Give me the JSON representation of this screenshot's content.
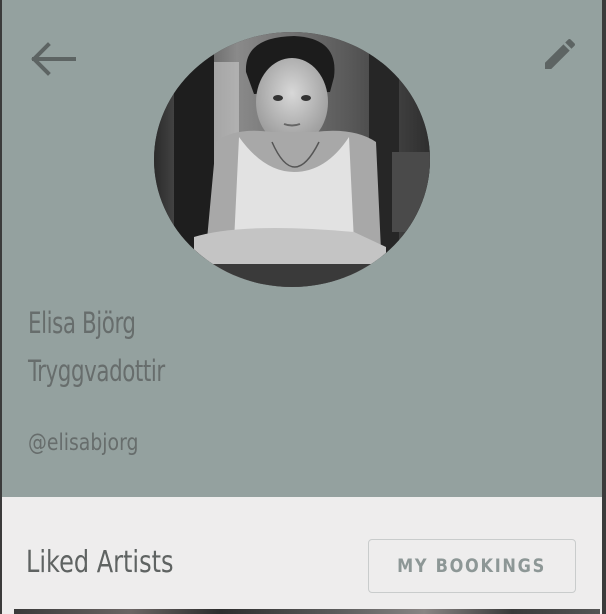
{
  "header": {
    "background_color": "#94a19f",
    "back_icon": "arrow-left-icon",
    "edit_icon": "pencil-icon"
  },
  "profile": {
    "name_line1": "Elisa Björg",
    "name_line2": "Tryggvadottir",
    "handle": "@elisabjorg",
    "avatar": "profile-photo"
  },
  "liked_section": {
    "title": "Liked Artists",
    "bookings_button_label": "MY BOOKINGS"
  }
}
